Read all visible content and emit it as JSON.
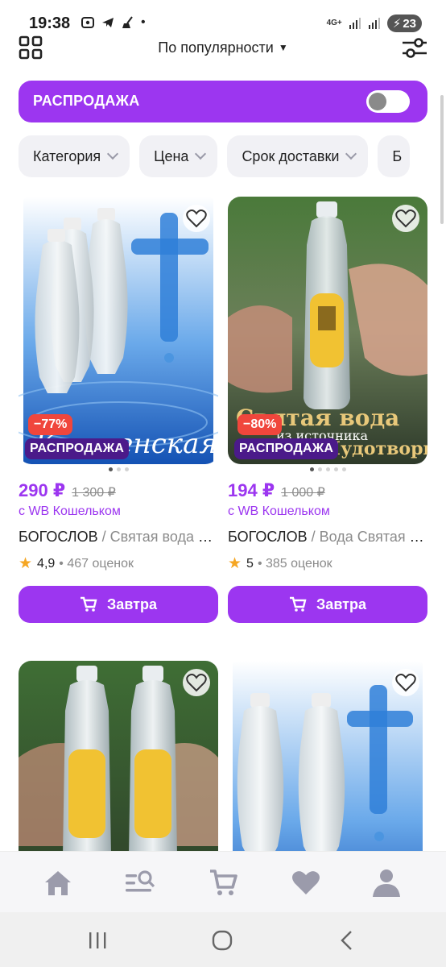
{
  "status_bar": {
    "time": "19:38",
    "network": "4G+",
    "battery": "23"
  },
  "top_bar": {
    "sort_label": "По популярности"
  },
  "sale_toggle": {
    "label": "РАСПРОДАЖА",
    "enabled": false
  },
  "filters": [
    {
      "label": "Категория"
    },
    {
      "label": "Цена"
    },
    {
      "label": "Срок доставки"
    },
    {
      "label": "Б"
    }
  ],
  "products": [
    {
      "discount": "−77%",
      "sale_badge": "РАСПРОДАЖА",
      "price": "290 ₽",
      "old_price": "1 300 ₽",
      "wallet_note": "с WB Кошельком",
      "brand": "БОГОСЛОВ",
      "name": " / Святая вода Крещенская",
      "rating": "4,9",
      "reviews": "• 467 оценок",
      "delivery": "Завтра",
      "photo_caption": "Крещенская Вода"
    },
    {
      "discount": "−80%",
      "sale_badge": "РАСПРОДАЖА",
      "price": "194 ₽",
      "old_price": "1 000 ₽",
      "wallet_note": "с WB Кошельком",
      "brand": "БОГОСЛОВ",
      "name": " / Вода Святая из источника",
      "rating": "5",
      "reviews": "• 385 оценок",
      "delivery": "Завтра",
      "photo_caption": "Святая вода",
      "photo_caption2": "из источника",
      "photo_caption3": "Чудотворца"
    }
  ],
  "colors": {
    "accent": "#9c36f0",
    "discount": "#f0463c",
    "sale_badge": "#4b1a8a"
  },
  "bottom_nav": [
    "home-icon",
    "catalog-search-icon",
    "cart-icon",
    "favorites-icon",
    "profile-icon"
  ]
}
